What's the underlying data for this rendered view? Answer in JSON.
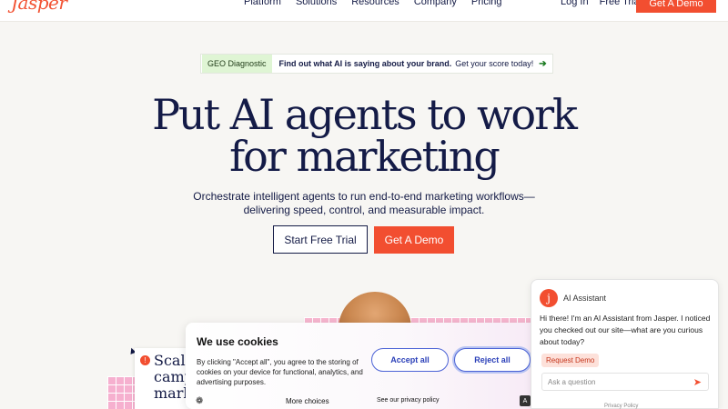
{
  "nav": {
    "logo": "Jasper",
    "links": [
      "Platform",
      "Solutions",
      "Resources",
      "Company",
      "Pricing"
    ],
    "login": "Log In",
    "free_trial": "Free Trial",
    "demo": "Get A Demo"
  },
  "banner": {
    "tag": "GEO Diagnostic",
    "bold": "Find out what AI is saying about your brand.",
    "text": "Get your score today!",
    "arrow": "➔"
  },
  "hero": {
    "title_line1": "Put AI agents to work",
    "title_line2": "for marketing",
    "sub_line1": "Orchestrate intelligent agents to run end-to-end marketing workflows—",
    "sub_line2": "delivering speed, control, and measurable impact.",
    "btn_trial": "Start Free Trial",
    "btn_demo": "Get A Demo"
  },
  "card": {
    "line1": "Scale",
    "line2": "camp",
    "line3": "mark",
    "dot": "!"
  },
  "cookie": {
    "title": "We use cookies",
    "text": "By clicking \"Accept all\", you agree to the storing of cookies on your device for functional, analytics, and advertising purposes.",
    "accept": "Accept all",
    "reject": "Reject all",
    "more": "More choices",
    "privacy": "See our privacy policy"
  },
  "chat": {
    "avatar": "j",
    "title": "AI Assistant",
    "message": "Hi there! I'm an AI Assistant from Jasper. I noticed you checked out our site—what are you curious about today?",
    "chip": "Request Demo",
    "placeholder": "Ask a question",
    "footer": "Privacy Policy"
  },
  "colors": {
    "brand": "#f24e30",
    "navy": "#131a45",
    "pink": "#f8b7d0",
    "geo_green": "#dff5d4"
  }
}
